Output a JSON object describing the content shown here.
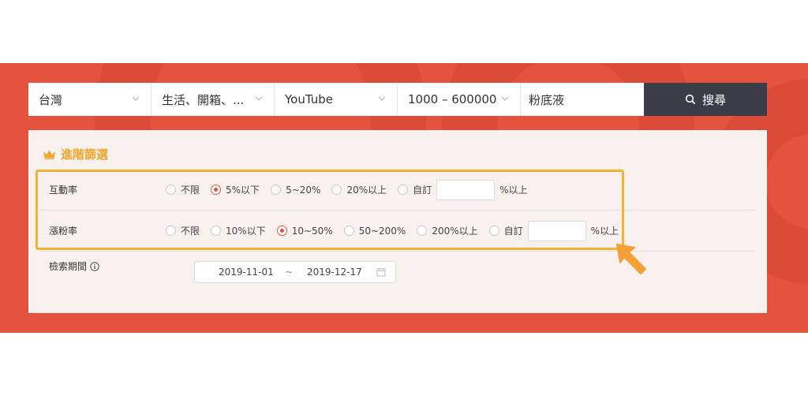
{
  "search": {
    "region": "台灣",
    "category": "生活、開箱、...",
    "platform": "YouTube",
    "followers": "1000 – 600000",
    "keyword": "粉底液",
    "button_label": "搜尋"
  },
  "advanced": {
    "title": "進階篩選",
    "engagement": {
      "label": "互動率",
      "options": [
        "不限",
        "5%以下",
        "5~20%",
        "20%以上",
        "自訂"
      ],
      "selected": "5%以下",
      "custom_suffix": "%以上"
    },
    "growth": {
      "label": "漲粉率",
      "options": [
        "不限",
        "10%以下",
        "10~50%",
        "50~200%",
        "200%以上",
        "自訂"
      ],
      "selected": "10~50%",
      "custom_suffix": "%以上"
    },
    "period": {
      "label": "檢索期間",
      "start": "2019-11-01",
      "separator": "~",
      "end": "2019-12-17"
    }
  },
  "colors": {
    "brand_red": "#e5533f",
    "accent_orange": "#f0a52c",
    "search_button": "#3a3d48"
  }
}
